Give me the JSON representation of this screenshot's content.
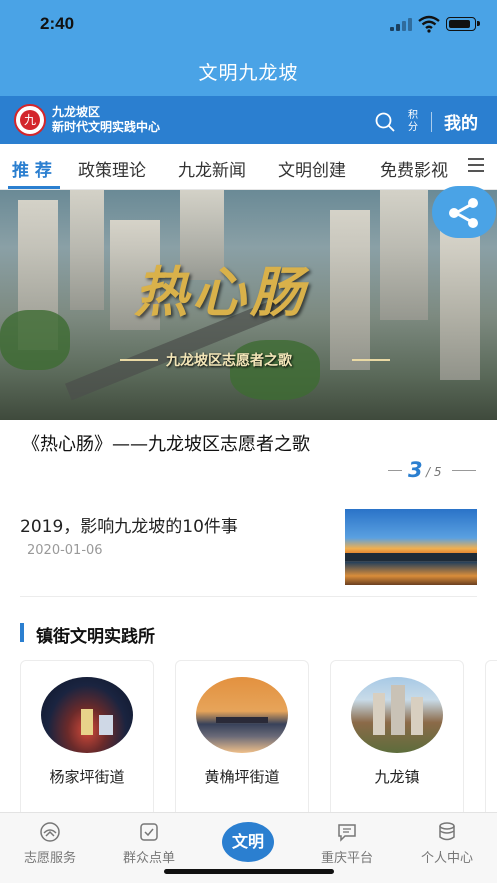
{
  "status_bar": {
    "time": "2:40"
  },
  "app": {
    "title": "文明九龙坡"
  },
  "brand": {
    "line1": "九龙坡区",
    "line2": "新时代文明实践中心",
    "logo_char": "九",
    "points_label": "积分",
    "mine_label": "我的"
  },
  "tabs": [
    "推 荐",
    "政策理论",
    "九龙新闻",
    "文明创建",
    "免费影视"
  ],
  "banner": {
    "title": "热心肠",
    "subtitle": "九龙坡区志愿者之歌",
    "caption": "《热心肠》——九龙坡区志愿者之歌",
    "page_current": "3",
    "page_total": "/ 5"
  },
  "news": [
    {
      "title": "2019，影响九龙坡的10件事",
      "date": "2020-01-06"
    }
  ],
  "section": {
    "title": "镇街文明实践所",
    "cards": [
      {
        "name": "杨家坪街道"
      },
      {
        "name": "黄桷坪街道"
      },
      {
        "name": "九龙镇"
      }
    ]
  },
  "bottom_nav": {
    "items": [
      {
        "label": "志愿服务",
        "icon": "volunteer-icon"
      },
      {
        "label": "群众点单",
        "icon": "order-icon"
      },
      {
        "label": "重庆平台",
        "icon": "chat-icon"
      },
      {
        "label": "个人中心",
        "icon": "profile-icon"
      }
    ],
    "center_label": "文明"
  },
  "colors": {
    "primary": "#2b7fd0",
    "header": "#4aa3e6"
  }
}
